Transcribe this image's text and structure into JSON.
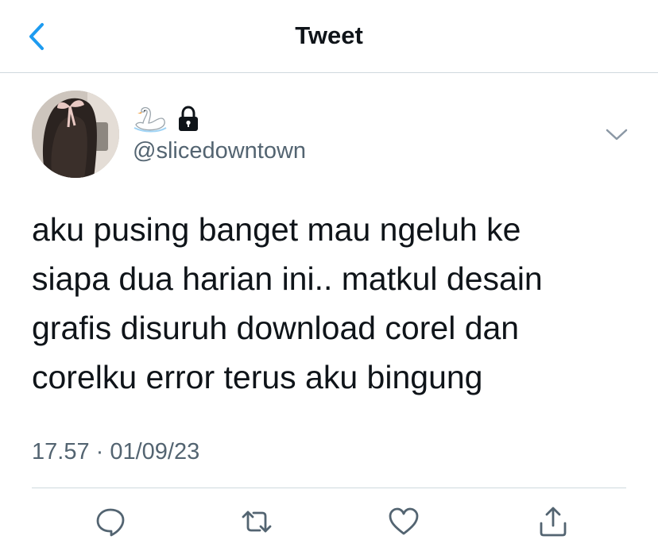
{
  "header": {
    "back_icon": "chevron-left-icon",
    "title": "Tweet"
  },
  "colors": {
    "accent": "#1d9bf0",
    "text_primary": "#0f1419",
    "text_secondary": "#536471",
    "divider": "#cfd9de",
    "icon_gray": "#536471"
  },
  "author": {
    "display_name_icons": [
      "swan-emoji-icon",
      "lock-icon"
    ],
    "handle": "@slicedowntown"
  },
  "tweet": {
    "lines": [
      "aku pusing banget mau ngeluh ke",
      "siapa dua harian ini.. matkul desain",
      "grafis disuruh download corel dan",
      "corelku error terus aku bingung"
    ],
    "timestamp": "17.57 · 01/09/23"
  },
  "actions": [
    {
      "icon": "reply-icon"
    },
    {
      "icon": "retweet-icon"
    },
    {
      "icon": "like-icon"
    },
    {
      "icon": "share-icon"
    }
  ]
}
